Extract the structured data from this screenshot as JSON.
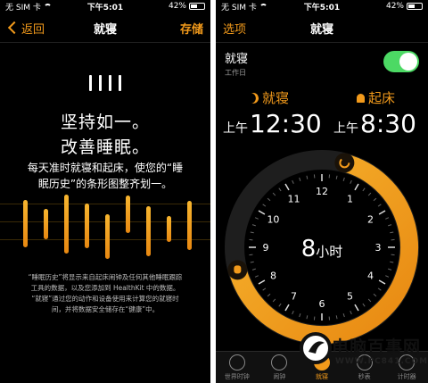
{
  "left": {
    "status": {
      "carrier": "无 SIM 卡",
      "time": "下午5:01",
      "battery": "42%"
    },
    "nav": {
      "back": "返回",
      "title": "就寝",
      "save": "存储"
    },
    "hero": [
      "坚持如一。",
      "改善睡眠。"
    ],
    "description": [
      "每天准时就寝和起床，使您的“睡",
      "眠历史”的条形图整齐划一。"
    ],
    "bars": [
      {
        "top": 0.08,
        "bottom": 0.82
      },
      {
        "top": 0.22,
        "bottom": 0.7
      },
      {
        "top": 0.0,
        "bottom": 0.92
      },
      {
        "top": 0.14,
        "bottom": 0.84
      },
      {
        "top": 0.3,
        "bottom": 1.0
      },
      {
        "top": 0.02,
        "bottom": 0.6
      },
      {
        "top": 0.18,
        "bottom": 0.96
      },
      {
        "top": 0.34,
        "bottom": 0.74
      },
      {
        "top": 0.1,
        "bottom": 0.86
      }
    ],
    "footer": [
      "“睡眠历史”将显示来自起床闹钟及任何其他睡眠跟踪",
      "工具的数据，以及您添加到 HealthKit 中的数据。",
      "“就寝”通过您的动作和设备使用来计算您的就寝时",
      "间，并将数据安全储存在“健康”中。"
    ]
  },
  "right": {
    "status": {
      "carrier": "无 SIM 卡",
      "time": "下午5:01",
      "battery": "42%"
    },
    "nav": {
      "options": "选项",
      "title": "就寝"
    },
    "bedtime_row": {
      "title": "就寝",
      "subtitle": "工作日"
    },
    "bed": {
      "label": "就寝",
      "ampm": "上午",
      "time": "12:30"
    },
    "wake": {
      "label": "起床",
      "ampm": "上午",
      "time": "8:30"
    },
    "duration": {
      "number": "8",
      "unit": "小时"
    },
    "clock_numbers": [
      "12",
      "1",
      "2",
      "3",
      "4",
      "5",
      "6",
      "7",
      "8",
      "9",
      "10",
      "11"
    ],
    "tabs": [
      {
        "label": "世界时钟",
        "active": false
      },
      {
        "label": "闹钟",
        "active": false
      },
      {
        "label": "就寝",
        "active": true
      },
      {
        "label": "秒表",
        "active": false
      },
      {
        "label": "计时器",
        "active": false
      }
    ]
  },
  "watermark": {
    "name": "电脑百事网",
    "url": "WWW.PC841.COM"
  },
  "colors": {
    "accent": "#f29a1b",
    "toggle": "#4cd964"
  }
}
